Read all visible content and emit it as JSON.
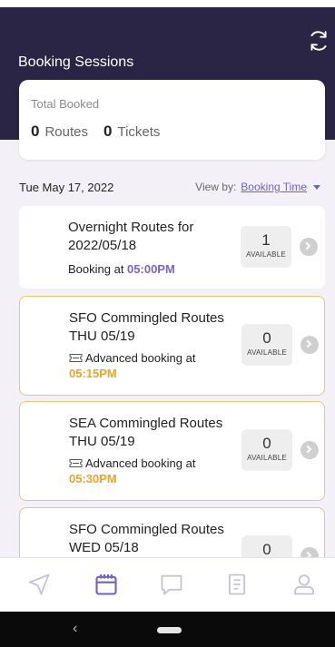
{
  "header": {
    "title": "Booking Sessions",
    "refresh_icon": "refresh-icon"
  },
  "summary": {
    "label": "Total Booked",
    "routes_count": "0",
    "routes_label": "Routes",
    "tickets_count": "0",
    "tickets_label": "Tickets"
  },
  "filter": {
    "date": "Tue May 17, 2022",
    "view_by_label": "View by:",
    "view_by_value": "Booking Time"
  },
  "sessions": [
    {
      "title": "Overnight Routes for 2022/05/18",
      "prefix": "Booking at ",
      "time": "05:00PM",
      "available": "1",
      "available_label": "AVAILABLE"
    },
    {
      "title": "SFO Commingled Routes THU 05/19",
      "prefix": "Advanced booking at",
      "time": "05:15PM",
      "available": "0",
      "available_label": "AVAILABLE"
    },
    {
      "title": "SEA Commingled Routes THU 05/19",
      "prefix": "Advanced booking at",
      "time": "05:30PM",
      "available": "0",
      "available_label": "AVAILABLE"
    },
    {
      "title": "SFO Commingled Routes WED 05/18",
      "available": "0"
    }
  ],
  "tabs": [
    "navigation-icon",
    "calendar-icon",
    "chat-icon",
    "receipt-icon",
    "profile-icon"
  ],
  "colors": {
    "header": "#2a2544",
    "accent": "#6e62c9",
    "orange": "#f2a51b",
    "highlight_border": "#f0c46a"
  }
}
